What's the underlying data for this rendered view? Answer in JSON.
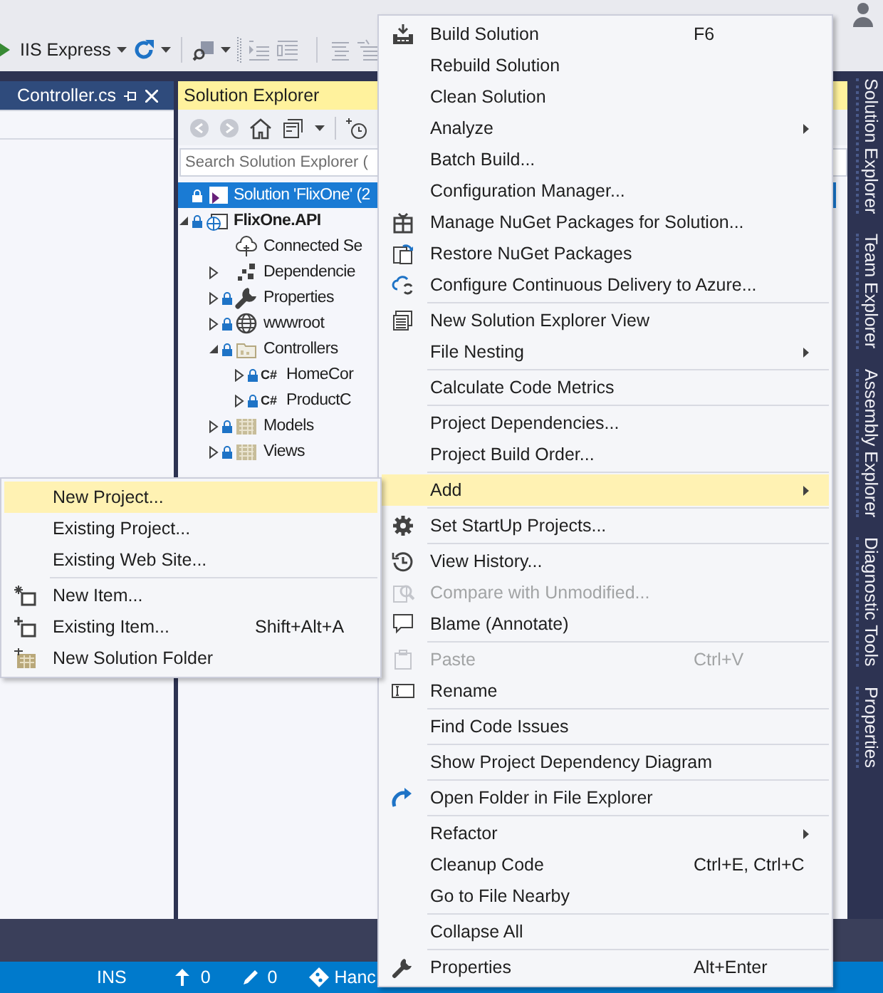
{
  "toolbar": {
    "run_target": "IIS Express"
  },
  "document_tab": {
    "title": "Controller.cs"
  },
  "solution_explorer": {
    "title": "Solution Explorer",
    "search": {
      "placeholder": "Search Solution Explorer ("
    },
    "tree": [
      {
        "kind": "solution",
        "label": "Solution 'FlixOne' (2",
        "locked": true,
        "selected": true
      },
      {
        "kind": "project",
        "label": "FlixOne.API",
        "expanded": true,
        "locked": true,
        "selected": false,
        "children": [
          {
            "kind": "service",
            "label": "Connected Se",
            "locked": false,
            "selected": false
          },
          {
            "kind": "dependencies",
            "label": "Dependencie",
            "expanded": false,
            "locked": false,
            "selected": false
          },
          {
            "kind": "properties",
            "label": "Properties",
            "expanded": false,
            "locked": true,
            "selected": false
          },
          {
            "kind": "web-root",
            "label": "wwwroot",
            "expanded": false,
            "locked": true,
            "selected": false
          },
          {
            "kind": "folder",
            "label": "Controllers",
            "expanded": true,
            "locked": true,
            "selected": false,
            "children": [
              {
                "kind": "cs-file",
                "badge": "C#",
                "label": "HomeCor",
                "expanded": false,
                "locked": true,
                "selected": false
              },
              {
                "kind": "cs-file",
                "badge": "C#",
                "label": "ProductC",
                "expanded": false,
                "locked": true,
                "selected": false
              }
            ]
          },
          {
            "kind": "folder-grid",
            "label": "Models",
            "expanded": false,
            "locked": true,
            "selected": false
          },
          {
            "kind": "folder-grid",
            "label": "Views",
            "expanded": false,
            "locked": true,
            "selected": false
          }
        ]
      }
    ]
  },
  "side_tabs": [
    "Solution Explorer",
    "Team Explorer",
    "Assembly Explorer",
    "Diagnostic Tools",
    "Properties"
  ],
  "status_bar": {
    "mode": "INS",
    "outgoing": "0",
    "pending": "0",
    "branch": "Hanc"
  },
  "context_menu": {
    "items": [
      {
        "kind": "item",
        "label": "Build Solution",
        "shortcut": "F6",
        "submenu": false,
        "disabled": false,
        "selected": false
      },
      {
        "kind": "item",
        "label": "Rebuild Solution",
        "submenu": false,
        "disabled": false,
        "selected": false
      },
      {
        "kind": "item",
        "label": "Clean Solution",
        "submenu": false,
        "disabled": false,
        "selected": false
      },
      {
        "kind": "item",
        "label": "Analyze",
        "submenu": true,
        "disabled": false,
        "selected": false
      },
      {
        "kind": "item",
        "label": "Batch Build...",
        "submenu": false,
        "disabled": false,
        "selected": false
      },
      {
        "kind": "item",
        "label": "Configuration Manager...",
        "submenu": false,
        "disabled": false,
        "selected": false
      },
      {
        "kind": "item",
        "label": "Manage NuGet Packages for Solution...",
        "submenu": false,
        "disabled": false,
        "selected": false
      },
      {
        "kind": "item",
        "label": "Restore NuGet Packages",
        "submenu": false,
        "disabled": false,
        "selected": false
      },
      {
        "kind": "item",
        "label": "Configure Continuous Delivery to Azure...",
        "submenu": false,
        "disabled": false,
        "selected": false
      },
      {
        "kind": "separator"
      },
      {
        "kind": "item",
        "label": "New Solution Explorer View",
        "submenu": false,
        "disabled": false,
        "selected": false
      },
      {
        "kind": "item",
        "label": "File Nesting",
        "submenu": true,
        "disabled": false,
        "selected": false
      },
      {
        "kind": "separator"
      },
      {
        "kind": "item",
        "label": "Calculate Code Metrics",
        "submenu": false,
        "disabled": false,
        "selected": false
      },
      {
        "kind": "separator"
      },
      {
        "kind": "item",
        "label": "Project Dependencies...",
        "submenu": false,
        "disabled": false,
        "selected": false
      },
      {
        "kind": "item",
        "label": "Project Build Order...",
        "submenu": false,
        "disabled": false,
        "selected": false
      },
      {
        "kind": "separator"
      },
      {
        "kind": "item",
        "label": "Add",
        "submenu": true,
        "disabled": false,
        "selected": true
      },
      {
        "kind": "separator"
      },
      {
        "kind": "item",
        "label": "Set StartUp Projects...",
        "submenu": false,
        "disabled": false,
        "selected": false
      },
      {
        "kind": "separator"
      },
      {
        "kind": "item",
        "label": "View History...",
        "submenu": false,
        "disabled": false,
        "selected": false
      },
      {
        "kind": "item",
        "label": "Compare with Unmodified...",
        "submenu": false,
        "disabled": true,
        "selected": false
      },
      {
        "kind": "item",
        "label": "Blame (Annotate)",
        "submenu": false,
        "disabled": false,
        "selected": false
      },
      {
        "kind": "separator"
      },
      {
        "kind": "item",
        "label": "Paste",
        "shortcut": "Ctrl+V",
        "submenu": false,
        "disabled": true,
        "selected": false
      },
      {
        "kind": "item",
        "label": "Rename",
        "submenu": false,
        "disabled": false,
        "selected": false
      },
      {
        "kind": "separator"
      },
      {
        "kind": "item",
        "label": "Find Code Issues",
        "submenu": false,
        "disabled": false,
        "selected": false
      },
      {
        "kind": "separator"
      },
      {
        "kind": "item",
        "label": "Show Project Dependency Diagram",
        "submenu": false,
        "disabled": false,
        "selected": false
      },
      {
        "kind": "separator"
      },
      {
        "kind": "item",
        "label": "Open Folder in File Explorer",
        "submenu": false,
        "disabled": false,
        "selected": false
      },
      {
        "kind": "separator"
      },
      {
        "kind": "item",
        "label": "Refactor",
        "submenu": true,
        "disabled": false,
        "selected": false
      },
      {
        "kind": "item",
        "label": "Cleanup Code",
        "shortcut": "Ctrl+E, Ctrl+C",
        "submenu": false,
        "disabled": false,
        "selected": false
      },
      {
        "kind": "item",
        "label": "Go to File Nearby",
        "submenu": false,
        "disabled": false,
        "selected": false
      },
      {
        "kind": "separator"
      },
      {
        "kind": "item",
        "label": "Collapse All",
        "submenu": false,
        "disabled": false,
        "selected": false
      },
      {
        "kind": "separator"
      },
      {
        "kind": "item",
        "label": "Properties",
        "shortcut": "Alt+Enter",
        "submenu": false,
        "disabled": false,
        "selected": false
      }
    ]
  },
  "add_submenu": {
    "items": [
      {
        "kind": "item",
        "label": "New Project...",
        "submenu": false,
        "disabled": false,
        "selected": true
      },
      {
        "kind": "item",
        "label": "Existing Project...",
        "submenu": false,
        "disabled": false,
        "selected": false
      },
      {
        "kind": "item",
        "label": "Existing Web Site...",
        "submenu": false,
        "disabled": false,
        "selected": false
      },
      {
        "kind": "separator"
      },
      {
        "kind": "item",
        "label": "New Item...",
        "submenu": false,
        "disabled": false,
        "selected": false
      },
      {
        "kind": "item",
        "label": "Existing Item...",
        "shortcut": "Shift+Alt+A",
        "submenu": false,
        "disabled": false,
        "selected": false
      },
      {
        "kind": "item",
        "label": "New Solution Folder",
        "submenu": false,
        "disabled": false,
        "selected": false
      }
    ]
  }
}
